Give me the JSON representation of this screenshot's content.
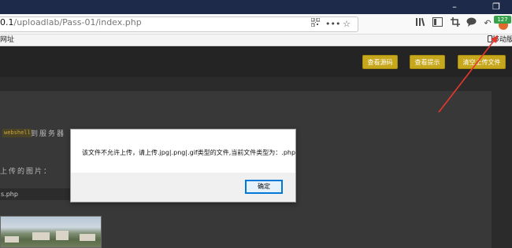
{
  "browser": {
    "url_host": "0.1",
    "url_path": "/uploadlab/Pass-01/index.php",
    "bookmarks_left": "网址",
    "bookmarks_right": "移动版",
    "ext_badge": "127",
    "icons": [
      "qr-code-icon",
      "more-dots-icon",
      "star-icon",
      "library-icon",
      "sidebar-icon",
      "crop-icon",
      "chat-icon",
      "undo-icon",
      "extension-icon"
    ]
  },
  "page": {
    "buttons": {
      "view_source": "查看源码",
      "view_hint": "查看提示",
      "clear_upload": "清空上传文件"
    },
    "webshell_tag": "webshell",
    "upload_text": "到服务器",
    "uploaded_label": "上传的图片：",
    "file_name": "s.php"
  },
  "dialog": {
    "message": "该文件不允许上传，请上传.jpg|.png|.gif类型的文件,当前文件类型为：.php",
    "ok_label": "确定"
  },
  "colors": {
    "accent_button": "#c7a71b",
    "annotation_arrow": "#e8362a",
    "dialog_focus": "#0078d7"
  }
}
